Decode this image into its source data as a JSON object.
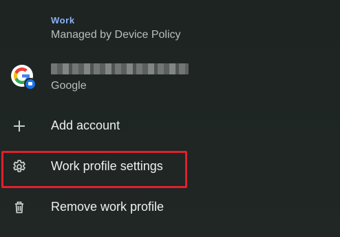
{
  "section": {
    "title": "Work",
    "subtitle": "Managed by Device Policy"
  },
  "account": {
    "email_redacted": "(redacted email)",
    "type": "Google",
    "avatar_icon": "google-g-icon",
    "badge_icon": "work-briefcase-badge-icon"
  },
  "menu": [
    {
      "id": "add-account",
      "label": "Add account",
      "icon": "plus-icon"
    },
    {
      "id": "work-profile-settings",
      "label": "Work profile settings",
      "icon": "gear-icon"
    },
    {
      "id": "remove-work-profile",
      "label": "Remove work profile",
      "icon": "trash-icon"
    }
  ],
  "colors": {
    "background": "#1f2624",
    "section_title": "#8ab4f8",
    "secondary_text": "#b9bfbc",
    "primary_text": "#eef0ef",
    "highlight": "#e2202c"
  }
}
